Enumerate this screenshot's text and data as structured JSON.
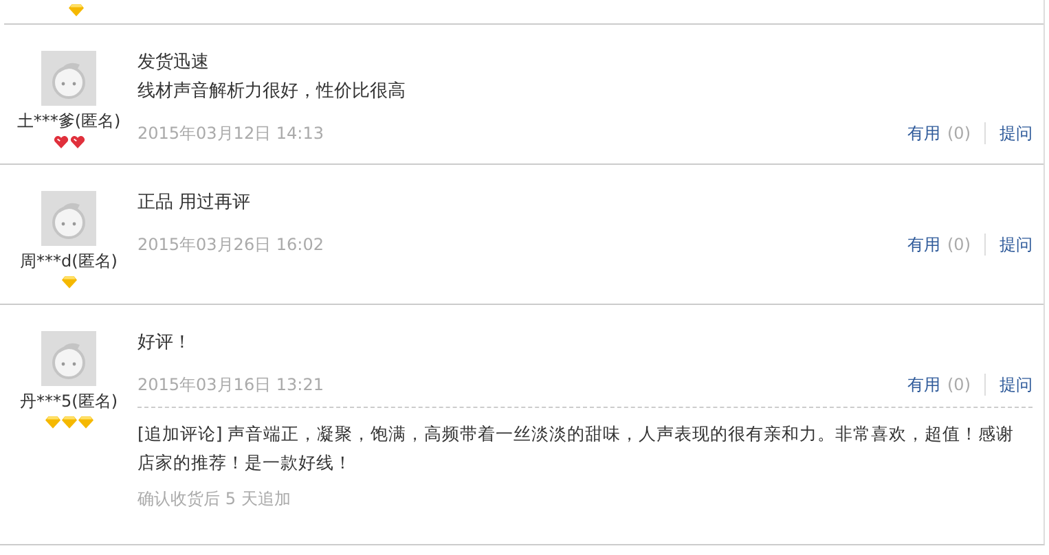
{
  "previous_review": {
    "badge_icons": [
      {
        "kind": "diamond"
      }
    ]
  },
  "reviews": [
    {
      "user": "土***爹(匿名)",
      "badge_icons": [
        {
          "kind": "heart"
        },
        {
          "kind": "heart"
        }
      ],
      "lines": [
        "发货迅速",
        "线材声音解析力很好，性价比很高"
      ],
      "date": "2015年03月12日 14:13",
      "useful_label": "有用",
      "useful_count": "(0)",
      "ask_label": "提问"
    },
    {
      "user": "周***d(匿名)",
      "badge_icons": [
        {
          "kind": "diamond"
        }
      ],
      "lines": [
        "正品 用过再评"
      ],
      "date": "2015年03月26日 16:02",
      "useful_label": "有用",
      "useful_count": "(0)",
      "ask_label": "提问"
    },
    {
      "user": "丹***5(匿名)",
      "badge_icons": [
        {
          "kind": "diamond"
        },
        {
          "kind": "diamond"
        },
        {
          "kind": "diamond"
        }
      ],
      "lines": [
        "好评！"
      ],
      "date": "2015年03月16日 13:21",
      "useful_label": "有用",
      "useful_count": "(0)",
      "ask_label": "提问",
      "append": {
        "text": "[追加评论] 声音端正，凝聚，饱满，高频带着一丝淡淡的甜味，人声表现的很有亲和力。非常喜欢，超值！感谢店家的推荐！是一款好线！",
        "note": "确认收货后 5 天追加"
      }
    }
  ]
}
